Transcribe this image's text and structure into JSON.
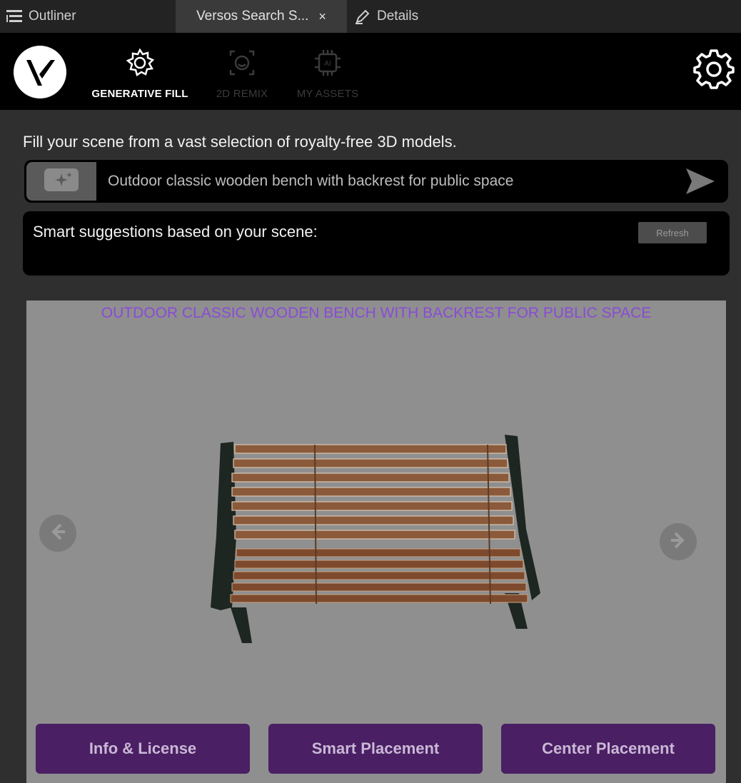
{
  "tabs": {
    "outliner": "Outliner",
    "search": "Versos Search S...",
    "search_close": "×",
    "details": "Details"
  },
  "header": {
    "nav": [
      {
        "label": "GENERATIVE FILL",
        "icon": "gear-flower-icon",
        "active": true
      },
      {
        "label": "2D REMIX",
        "icon": "remix-icon",
        "active": false
      },
      {
        "label": "MY ASSETS",
        "icon": "ai-chip-icon",
        "active": false
      }
    ]
  },
  "main": {
    "tagline": "Fill your scene from a vast selection of royalty-free 3D models.",
    "search_value": "Outdoor classic wooden bench with backrest for public space",
    "suggestions_title": "Smart suggestions based on your scene:",
    "refresh_label": "Refresh"
  },
  "preview": {
    "title": "OUTDOOR CLASSIC WOODEN BENCH WITH BACKREST FOR PUBLIC SPACE",
    "title_color": "#8a4bd6"
  },
  "actions": {
    "info": "Info & License",
    "smart": "Smart Placement",
    "center": "Center Placement"
  },
  "colors": {
    "action_bg": "#4a1f63",
    "header_bg": "#000000",
    "preview_bg": "#8f8f8f"
  }
}
